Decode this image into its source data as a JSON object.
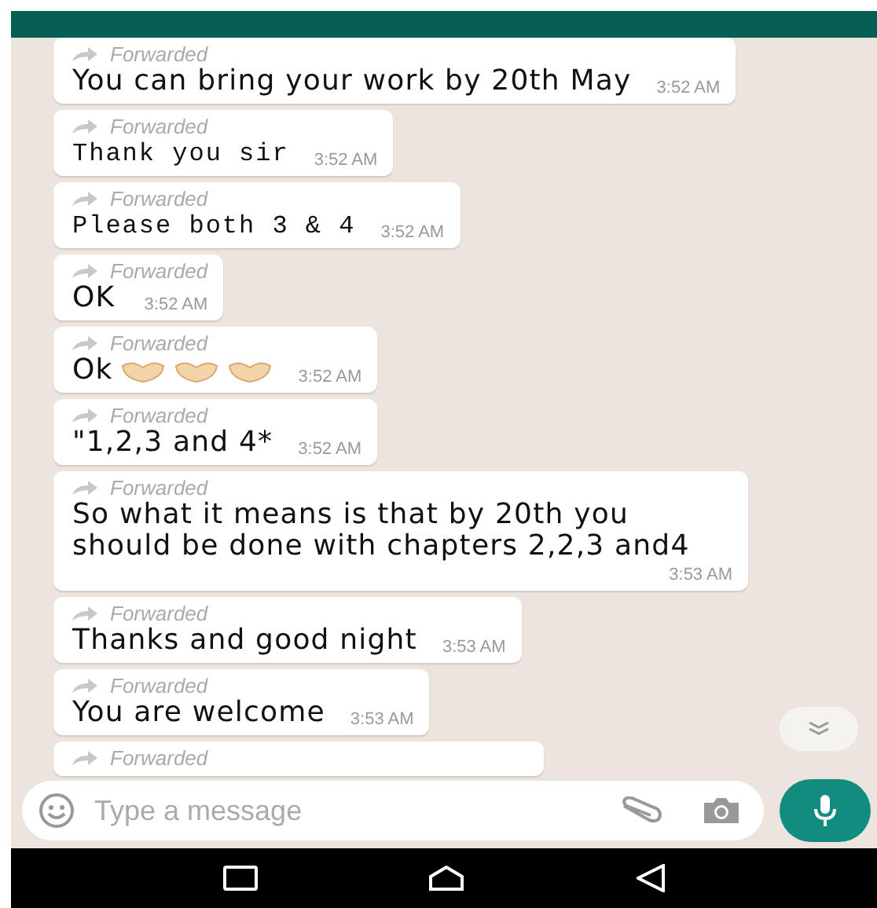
{
  "messages": [
    {
      "forwarded_label": "Forwarded",
      "text": "You can bring your work by 20th May",
      "time": "3:52 AM",
      "kind": "text"
    },
    {
      "forwarded_label": "Forwarded",
      "text": "Thank you sir",
      "time": "3:52 AM",
      "kind": "mono"
    },
    {
      "forwarded_label": "Forwarded",
      "text": "Please both 3 & 4",
      "time": "3:52 AM",
      "kind": "mono"
    },
    {
      "forwarded_label": "Forwarded",
      "text": "OK",
      "time": "3:52 AM",
      "kind": "text"
    },
    {
      "forwarded_label": "Forwarded",
      "text": "Ok",
      "time": "3:52 AM",
      "kind": "emoji"
    },
    {
      "forwarded_label": "Forwarded",
      "text": "\"1,2,3 and 4*",
      "time": "3:52 AM",
      "kind": "text"
    },
    {
      "forwarded_label": "Forwarded",
      "text": "So what it means is that by 20th you should be done with chapters 2,2,3 and4",
      "time": "3:53 AM",
      "kind": "text"
    },
    {
      "forwarded_label": "Forwarded",
      "text": "Thanks and good night",
      "time": "3:53 AM",
      "kind": "text"
    },
    {
      "forwarded_label": "Forwarded",
      "text": "You are welcome",
      "time": "3:53 AM",
      "kind": "text"
    },
    {
      "forwarded_label": "Forwarded",
      "kind": "partial"
    }
  ],
  "composer": {
    "placeholder": "Type a message"
  }
}
